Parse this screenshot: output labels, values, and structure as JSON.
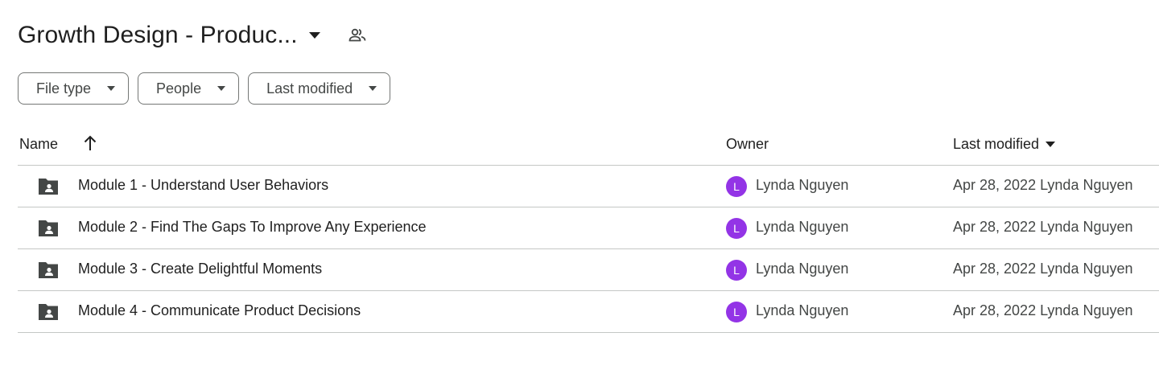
{
  "header": {
    "title": "Growth Design - Produc...",
    "caret_icon": "arrow-drop-down-icon",
    "shared_icon": "people-outline-icon"
  },
  "filters": [
    {
      "label": "File type"
    },
    {
      "label": "People"
    },
    {
      "label": "Last modified"
    }
  ],
  "columns": {
    "name": "Name",
    "owner": "Owner",
    "last_modified": "Last modified",
    "sort_icon": "arrow-upward-icon"
  },
  "rows": [
    {
      "name": "Module 1 - Understand User Behaviors",
      "owner_initial": "L",
      "owner": "Lynda Nguyen",
      "modified": "Apr 28, 2022 Lynda Nguyen"
    },
    {
      "name": "Module 2 - Find The Gaps To Improve Any Experience",
      "owner_initial": "L",
      "owner": "Lynda Nguyen",
      "modified": "Apr 28, 2022 Lynda Nguyen"
    },
    {
      "name": "Module 3 - Create Delightful Moments",
      "owner_initial": "L",
      "owner": "Lynda Nguyen",
      "modified": "Apr 28, 2022 Lynda Nguyen"
    },
    {
      "name": "Module 4 - Communicate Product Decisions",
      "owner_initial": "L",
      "owner": "Lynda Nguyen",
      "modified": "Apr 28, 2022 Lynda Nguyen"
    }
  ],
  "colors": {
    "avatar": "#9334e6",
    "border": "#c4c7c5",
    "icon": "#444746"
  }
}
